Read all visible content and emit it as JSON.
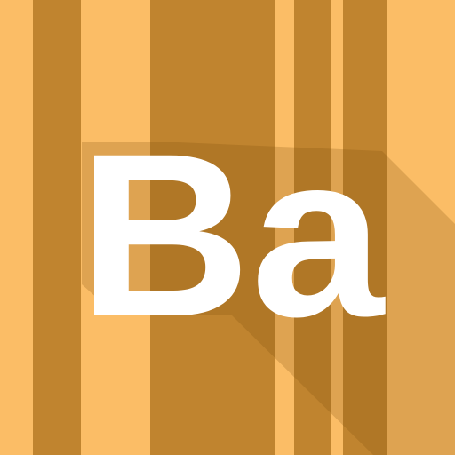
{
  "icon": {
    "text": "Ba",
    "colors": {
      "background": "#fbbd66",
      "stripe": "#c0842f",
      "text": "#ffffff",
      "shadow": "rgba(120, 72, 10, 0.22)"
    }
  }
}
